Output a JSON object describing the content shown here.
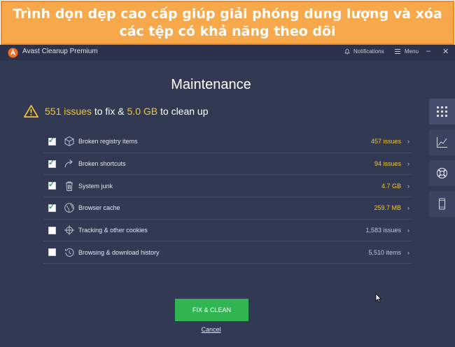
{
  "banner": {
    "text": "Trình dọn dẹp cao cấp giúp giải phóng dung lượng và xóa các tệp có khả năng theo dõi"
  },
  "window": {
    "title": "Avast Cleanup Premium",
    "notifications_label": "Notifications",
    "menu_label": "Menu"
  },
  "main": {
    "heading": "Maintenance",
    "summary": {
      "issues_count": "551 issues",
      "text_mid": " to fix & ",
      "size": "5.0 GB",
      "text_end": " to clean up"
    },
    "items": [
      {
        "label": "Broken registry items",
        "value": "457 issues",
        "checked": true,
        "icon": "registry-cube-icon"
      },
      {
        "label": "Broken shortcuts",
        "value": "94 issues",
        "checked": true,
        "icon": "shortcut-arrow-icon"
      },
      {
        "label": "System junk",
        "value": "4.7 GB",
        "checked": true,
        "icon": "trash-icon"
      },
      {
        "label": "Browser cache",
        "value": "259.7 MB",
        "checked": true,
        "icon": "globe-icon"
      },
      {
        "label": "Tracking & other cookies",
        "value": "1,583 issues",
        "checked": false,
        "icon": "crosshair-icon"
      },
      {
        "label": "Browsing & download history",
        "value": "5,510 items",
        "checked": false,
        "icon": "history-clock-icon"
      }
    ],
    "fix_button": "FIX & CLEAN",
    "cancel_link": "Cancel"
  },
  "sidebar": {
    "buttons": [
      "grid-icon",
      "chart-icon",
      "lifebuoy-icon",
      "phone-icon"
    ]
  },
  "colors": {
    "background": "#323a53",
    "accent_yellow": "#f5c432",
    "button_green": "#2fb552",
    "banner_orange": "#f7a84a"
  }
}
